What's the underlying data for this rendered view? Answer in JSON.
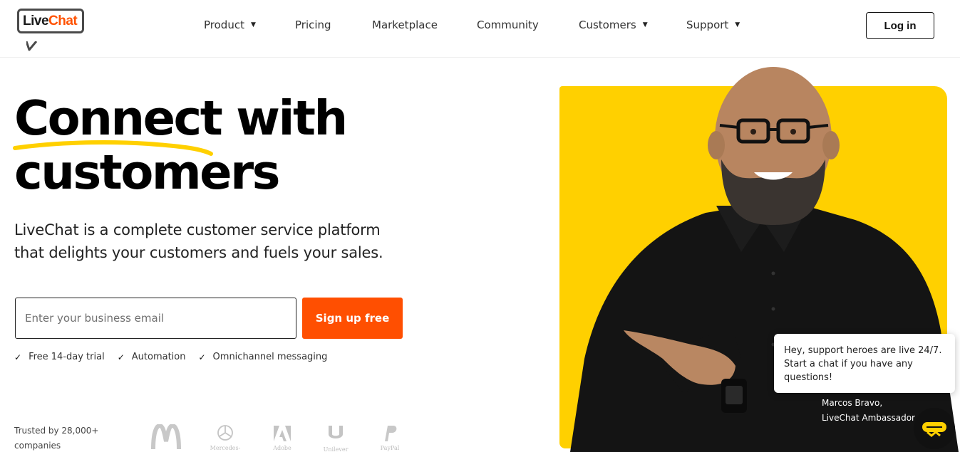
{
  "brand": {
    "name_part1": "Live",
    "name_part2": "Chat",
    "accent": "#ff5100"
  },
  "nav": {
    "items": [
      {
        "label": "Product",
        "has_dropdown": true
      },
      {
        "label": "Pricing",
        "has_dropdown": false
      },
      {
        "label": "Marketplace",
        "has_dropdown": false
      },
      {
        "label": "Community",
        "has_dropdown": false
      },
      {
        "label": "Customers",
        "has_dropdown": true
      },
      {
        "label": "Support",
        "has_dropdown": true
      }
    ],
    "caret": "▼",
    "login_label": "Log in"
  },
  "hero": {
    "title_word1": "Connect",
    "title_rest": " with",
    "title_line2": "customers",
    "subtitle_line1": "LiveChat is a complete customer service platform",
    "subtitle_line2": "that delights your customers and fuels your sales.",
    "email_placeholder": "Enter your business email",
    "cta_label": "Sign up free",
    "cta_color": "#ff4f01",
    "highlight_color": "#ffd000"
  },
  "features": [
    {
      "icon": "check-icon",
      "label": "Free 14-day trial"
    },
    {
      "icon": "check-icon",
      "label": "Automation"
    },
    {
      "icon": "check-icon",
      "label": "Omnichannel messaging"
    }
  ],
  "trusted": {
    "line1": "Trusted by 28,000+",
    "line2": "companies",
    "logos": [
      {
        "name": "mcdonalds-logo",
        "caption": ""
      },
      {
        "name": "mercedes-benz-logo",
        "caption": "Mercedes-Benz"
      },
      {
        "name": "adobe-logo",
        "caption": "Adobe"
      },
      {
        "name": "unilever-logo",
        "caption": "Unilever"
      },
      {
        "name": "paypal-logo",
        "caption": "PayPal"
      }
    ]
  },
  "ambassador": {
    "name": "Marcos Bravo,",
    "title": "LiveChat Ambassador"
  },
  "chat": {
    "message_line1": "Hey, support heroes are live 24/7.",
    "message_line2": "Start a chat if you have any",
    "message_line3": "questions!"
  },
  "colors": {
    "background": "#ffffff",
    "text": "#111111",
    "yellow": "#ffd000"
  }
}
